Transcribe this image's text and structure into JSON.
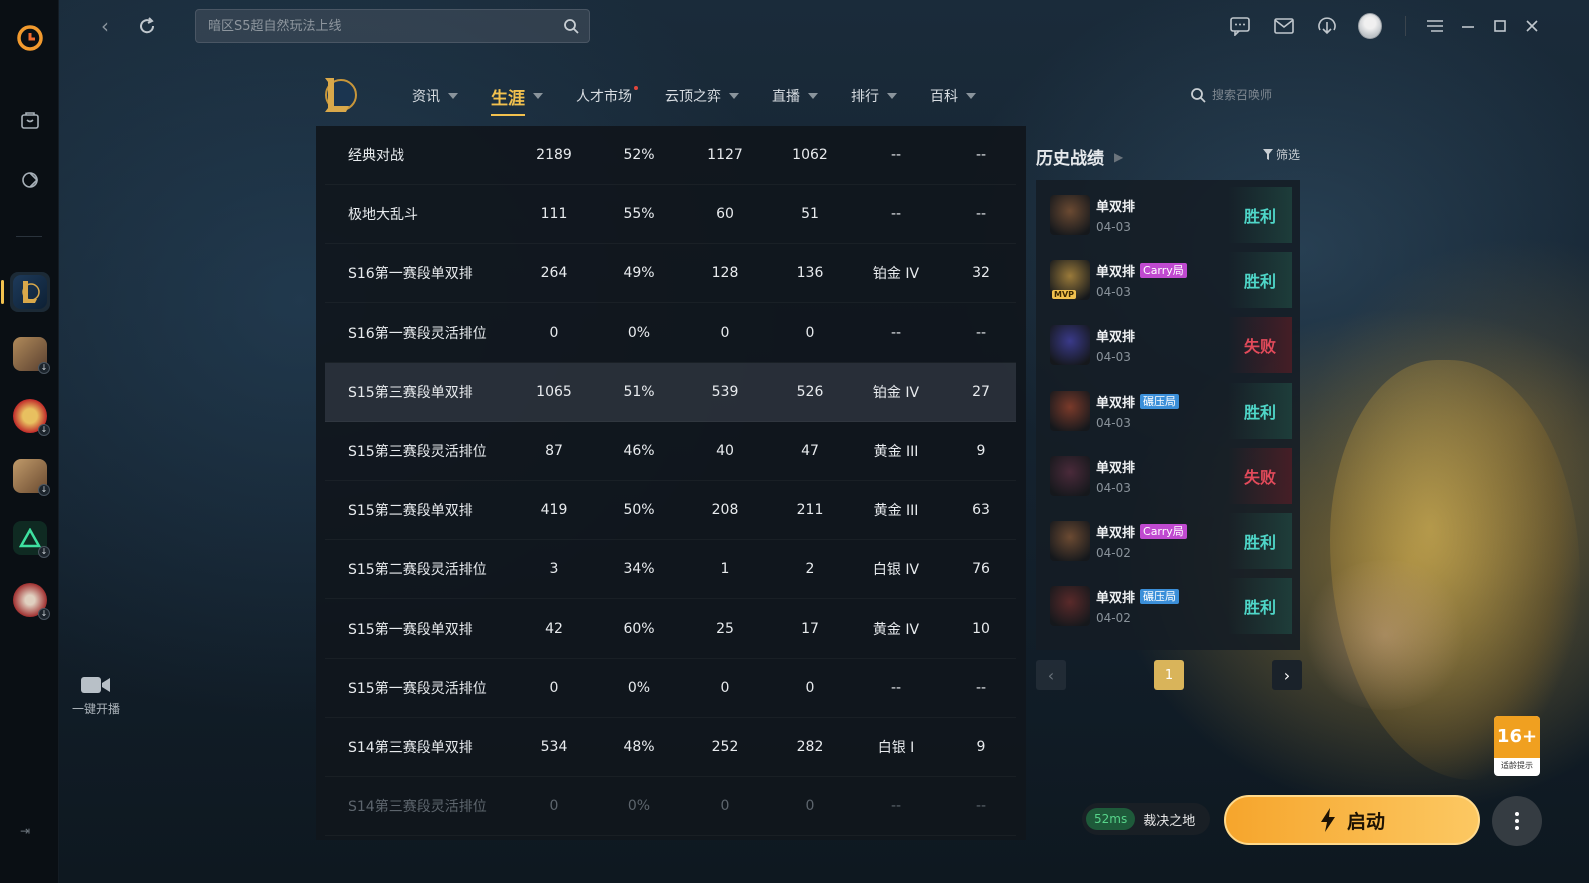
{
  "window": {
    "search_placeholder": "暗区S5超自然玩法上线"
  },
  "sidebar": {
    "stream_label": "一键开播"
  },
  "lol_nav": {
    "tabs": [
      {
        "label": "资讯",
        "caret": true
      },
      {
        "label": "生涯",
        "caret": true,
        "active": true
      },
      {
        "label": "人才市场",
        "caret": false,
        "dot": true
      },
      {
        "label": "云顶之弈",
        "caret": true
      },
      {
        "label": "直播",
        "caret": true
      },
      {
        "label": "排行",
        "caret": true
      },
      {
        "label": "百科",
        "caret": true
      }
    ],
    "summoner_search_placeholder": "搜索召唤师"
  },
  "career_table": {
    "rows": [
      {
        "mode": "经典对战",
        "total": "2189",
        "winrate": "52%",
        "wins": "1127",
        "losses": "1062",
        "rank": "--",
        "last": "--"
      },
      {
        "mode": "极地大乱斗",
        "total": "111",
        "winrate": "55%",
        "wins": "60",
        "losses": "51",
        "rank": "--",
        "last": "--"
      },
      {
        "mode": "S16第一赛段单双排",
        "total": "264",
        "winrate": "49%",
        "wins": "128",
        "losses": "136",
        "rank": "铂金 IV",
        "last": "32"
      },
      {
        "mode": "S16第一赛段灵活排位",
        "total": "0",
        "winrate": "0%",
        "wins": "0",
        "losses": "0",
        "rank": "--",
        "last": "--"
      },
      {
        "mode": "S15第三赛段单双排",
        "total": "1065",
        "winrate": "51%",
        "wins": "539",
        "losses": "526",
        "rank": "铂金 IV",
        "last": "27",
        "highlight": true
      },
      {
        "mode": "S15第三赛段灵活排位",
        "total": "87",
        "winrate": "46%",
        "wins": "40",
        "losses": "47",
        "rank": "黄金 III",
        "last": "9"
      },
      {
        "mode": "S15第二赛段单双排",
        "total": "419",
        "winrate": "50%",
        "wins": "208",
        "losses": "211",
        "rank": "黄金 III",
        "last": "63"
      },
      {
        "mode": "S15第二赛段灵活排位",
        "total": "3",
        "winrate": "34%",
        "wins": "1",
        "losses": "2",
        "rank": "白银 IV",
        "last": "76"
      },
      {
        "mode": "S15第一赛段单双排",
        "total": "42",
        "winrate": "60%",
        "wins": "25",
        "losses": "17",
        "rank": "黄金 IV",
        "last": "10"
      },
      {
        "mode": "S15第一赛段灵活排位",
        "total": "0",
        "winrate": "0%",
        "wins": "0",
        "losses": "0",
        "rank": "--",
        "last": "--"
      },
      {
        "mode": "S14第三赛段单双排",
        "total": "534",
        "winrate": "48%",
        "wins": "252",
        "losses": "282",
        "rank": "白银 I",
        "last": "9"
      },
      {
        "mode": "S14第三赛段灵活排位",
        "total": "0",
        "winrate": "0%",
        "wins": "0",
        "losses": "0",
        "rank": "--",
        "last": "--",
        "faded": true
      }
    ]
  },
  "history": {
    "title": "历史战绩",
    "filter_label": "筛选",
    "matches": [
      {
        "mode": "单双排",
        "tag": "",
        "date": "04-03",
        "result": "胜利",
        "win": true,
        "champ_color": "#6b4a32"
      },
      {
        "mode": "单双排",
        "tag": "Carry局",
        "tag_type": "carry",
        "mvp": "MVP",
        "date": "04-03",
        "result": "胜利",
        "win": true,
        "champ_color": "#9a7a3a"
      },
      {
        "mode": "单双排",
        "tag": "",
        "date": "04-03",
        "result": "失败",
        "win": false,
        "champ_color": "#3a3a8a"
      },
      {
        "mode": "单双排",
        "tag": "碾压局",
        "tag_type": "crush",
        "date": "04-03",
        "result": "胜利",
        "win": true,
        "champ_color": "#7a3a2a"
      },
      {
        "mode": "单双排",
        "tag": "",
        "date": "04-03",
        "result": "失败",
        "win": false,
        "champ_color": "#4a2a3a"
      },
      {
        "mode": "单双排",
        "tag": "Carry局",
        "tag_type": "carry",
        "date": "04-02",
        "result": "胜利",
        "win": true,
        "champ_color": "#6b4a32"
      },
      {
        "mode": "单双排",
        "tag": "碾压局",
        "tag_type": "crush",
        "date": "04-02",
        "result": "胜利",
        "win": true,
        "champ_color": "#5a2a2a"
      }
    ],
    "page": "1"
  },
  "footer": {
    "ping": "52ms",
    "server": "裁决之地",
    "launch_label": "启动",
    "age_rating": "16+",
    "age_rating_caption": "适龄提示"
  },
  "colors": {
    "accent": "#f2c14e",
    "win": "#4fd6c8",
    "lose": "#e24a5a",
    "launch": "#f6a52c"
  }
}
